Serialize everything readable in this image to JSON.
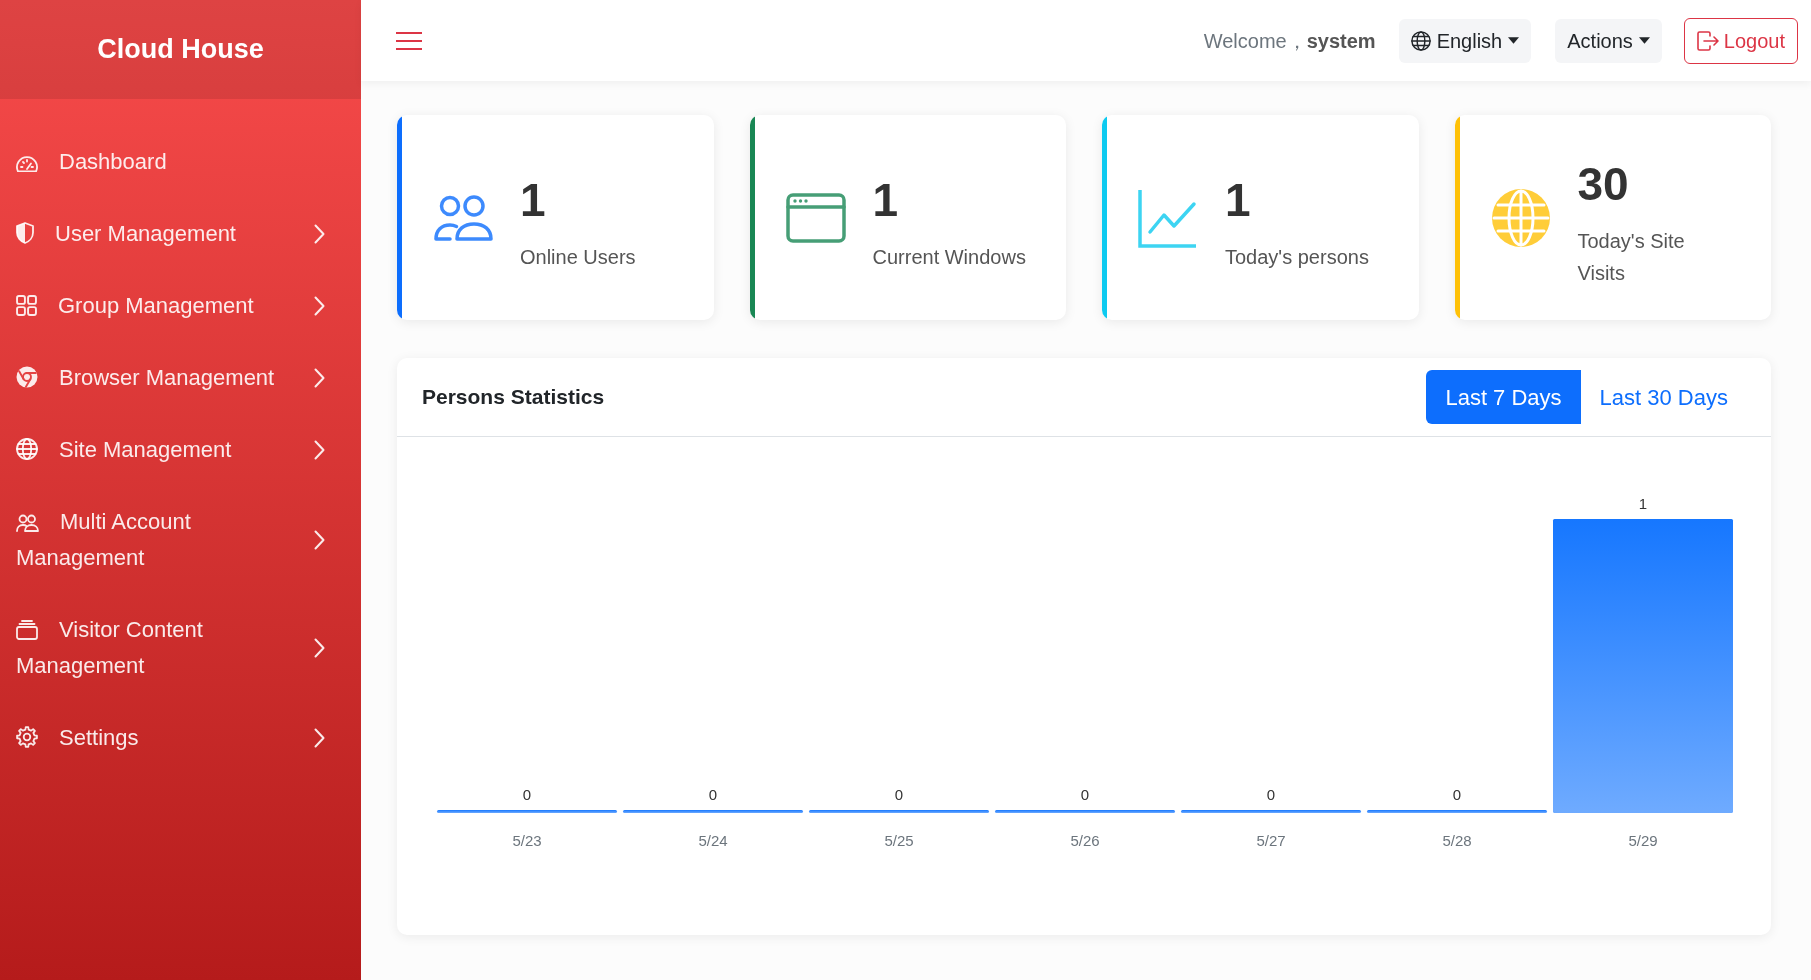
{
  "sidebar": {
    "brand": "Cloud House",
    "items": [
      {
        "label": "Dashboard",
        "submenu": false
      },
      {
        "label": "User Management",
        "submenu": true
      },
      {
        "label": "Group Management",
        "submenu": true
      },
      {
        "label": "Browser Management",
        "submenu": true
      },
      {
        "label": "Site Management",
        "submenu": true
      },
      {
        "label": "Multi Account Management",
        "submenu": true
      },
      {
        "label": "Visitor Content Management",
        "submenu": true
      },
      {
        "label": "Settings",
        "submenu": true
      }
    ]
  },
  "header": {
    "welcome": "Welcome，**system**",
    "language": "English",
    "actions": "Actions",
    "logout": "Logout"
  },
  "stats": [
    {
      "value": "1",
      "label": "Online Users",
      "color": "#0d6efd"
    },
    {
      "value": "1",
      "label": "Current Windows",
      "color": "#198754"
    },
    {
      "value": "1",
      "label": "Today's persons",
      "color": "#0dcaf0"
    },
    {
      "value": "30",
      "label": "Today's Site Visits",
      "color": "#ffc107"
    }
  ],
  "panel": {
    "title": "Persons Statistics",
    "tabs": [
      {
        "label": "Last 7 Days",
        "selected": true
      },
      {
        "label": "Last 30 Days",
        "selected": false
      }
    ],
    "chart_data": {
      "type": "bar",
      "categories": [
        "5/23",
        "5/24",
        "5/25",
        "5/26",
        "5/27",
        "5/28",
        "5/29"
      ],
      "series": [
        {
          "color": "#1677ff",
          "values": [
            0,
            0,
            0,
            0,
            0,
            0,
            1
          ]
        }
      ],
      "data_labels": true
    }
  }
}
